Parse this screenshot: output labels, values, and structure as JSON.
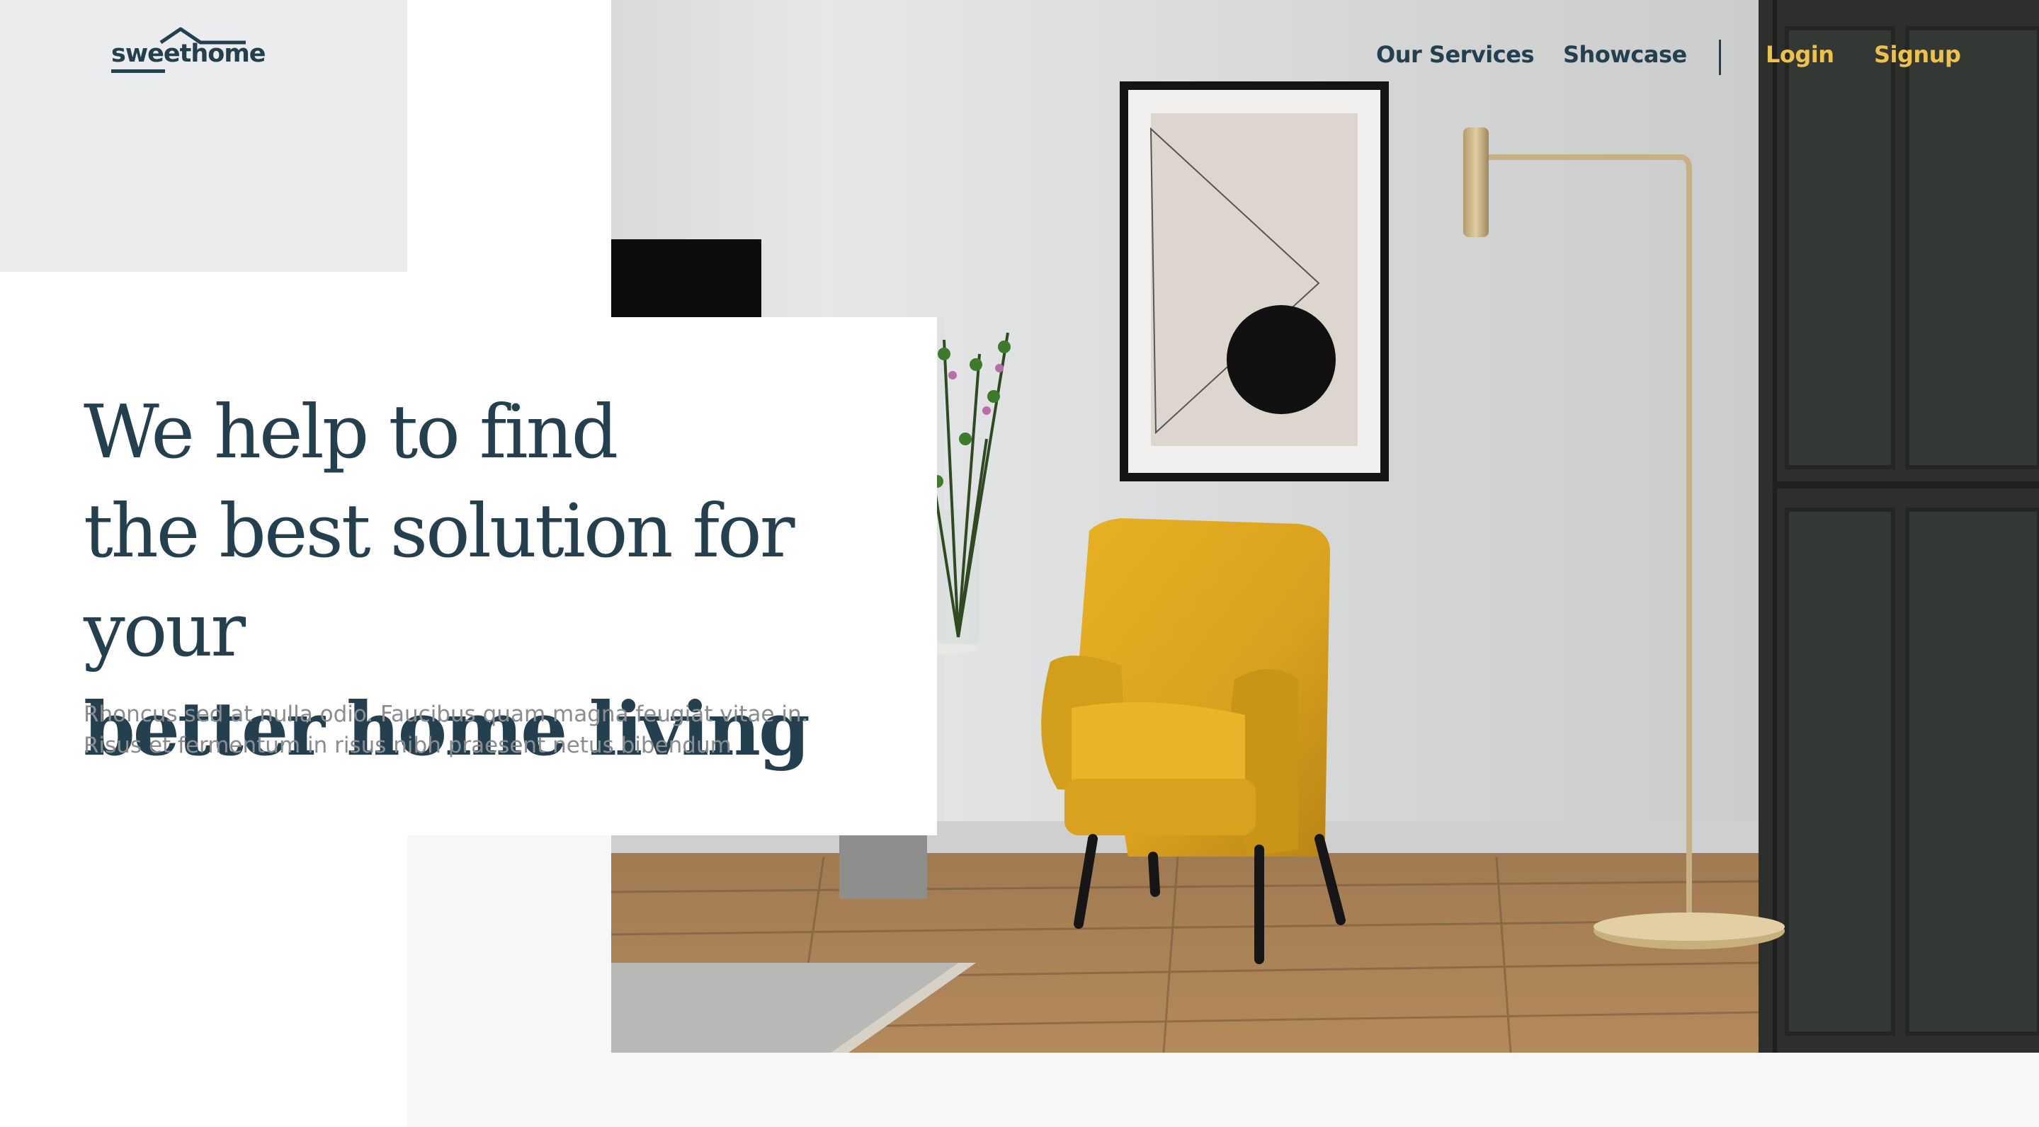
{
  "brand": {
    "logo_text": "sweethome"
  },
  "nav": {
    "services": "Our Services",
    "showcase": "Showcase",
    "login": "Login",
    "signup": "Signup"
  },
  "hero": {
    "headline_line1": "We help to find",
    "headline_line2": "the best solution for your",
    "headline_line3": "better home living",
    "subtext_line1": "Rhoncus sed at nulla odio. Faucibus quam magna feugiat vitae in.",
    "subtext_line2": "Risus et fermentum in risus nibh praesent netus bibendum"
  },
  "colors": {
    "primary": "#24404f",
    "accent": "#eec24a",
    "muted_text": "#8a8d90",
    "panel_grey": "#ebeced"
  }
}
